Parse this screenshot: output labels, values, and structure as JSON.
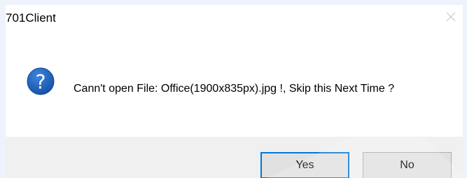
{
  "window": {
    "title": "701Client"
  },
  "message": {
    "text": "Cann't open File: Office(1900x835px).jpg !, Skip this Next Time ?",
    "icon": "question-icon"
  },
  "buttons": {
    "yes_label": "Yes",
    "no_label": "No"
  },
  "colors": {
    "icon_blue": "#1d5fb8",
    "default_button_border": "#0078d7",
    "footer_background": "#f0f0f0"
  }
}
